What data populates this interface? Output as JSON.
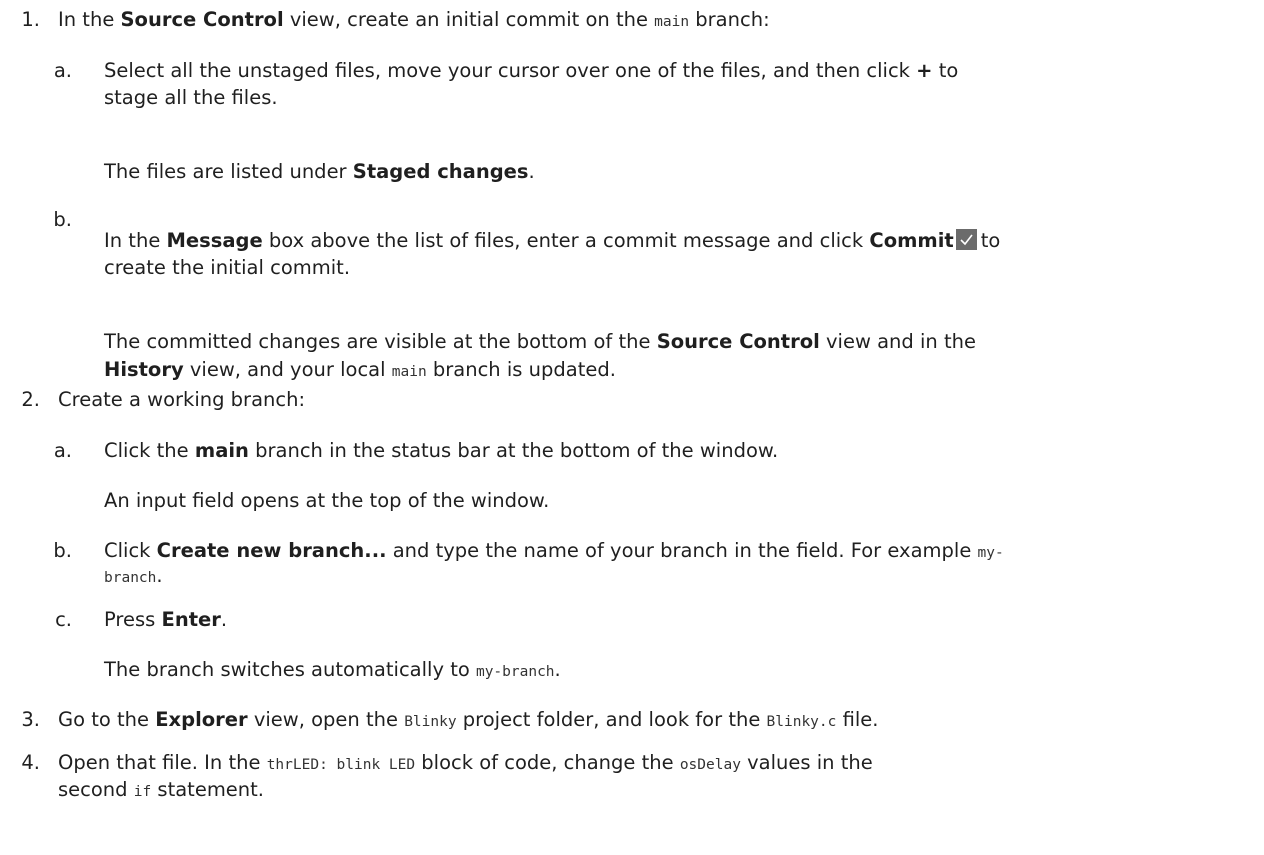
{
  "steps": [
    {
      "num": "1.",
      "line": [
        "In the ",
        "Source Control",
        " view, create an initial commit on the ",
        "main",
        " branch:"
      ],
      "substeps": [
        {
          "letter": "a.",
          "line1": [
            "Select all the unstaged files, move your cursor over one of the files, and then click ",
            "+",
            " to"
          ],
          "line2": "stage all the files.",
          "note": [
            "The files are listed under ",
            "Staged changes",
            "."
          ]
        },
        {
          "letter": "b.",
          "line1": [
            "In the ",
            "Message",
            " box above the list of files, enter a commit message and click ",
            "Commit",
            "to"
          ],
          "line2": "create the initial commit.",
          "note1": [
            "The committed changes are visible at the bottom of the ",
            "Source Control",
            " view and in the"
          ],
          "note2": [
            "History",
            " view, and your local ",
            "main",
            " branch is updated."
          ],
          "icon": "checkmark-icon"
        }
      ]
    },
    {
      "num": "2.",
      "line": "Create a working branch:",
      "substeps": [
        {
          "letter": "a.",
          "line1": [
            "Click the ",
            "main",
            " branch in the status bar at the bottom of the window."
          ],
          "note": "An input field opens at the top of the window."
        },
        {
          "letter": "b.",
          "line1": [
            "Click ",
            "Create new branch...",
            " and type the name of your branch in the field. For example ",
            "my-"
          ],
          "line2": "branch",
          "line2_end": "."
        },
        {
          "letter": "c.",
          "line1": [
            "Press ",
            "Enter",
            "."
          ],
          "note": [
            "The branch switches automatically to ",
            "my-branch",
            "."
          ]
        }
      ]
    },
    {
      "num": "3.",
      "line": [
        "Go to the ",
        "Explorer",
        " view, open the ",
        "Blinky",
        " project folder, and look for the ",
        "Blinky.c",
        " file."
      ]
    },
    {
      "num": "4.",
      "line1": [
        "Open that file. In the ",
        "thrLED: blink LED",
        " block of code, change the ",
        "osDelay",
        " values in the"
      ],
      "line2": [
        "second ",
        "if",
        " statement."
      ]
    }
  ]
}
